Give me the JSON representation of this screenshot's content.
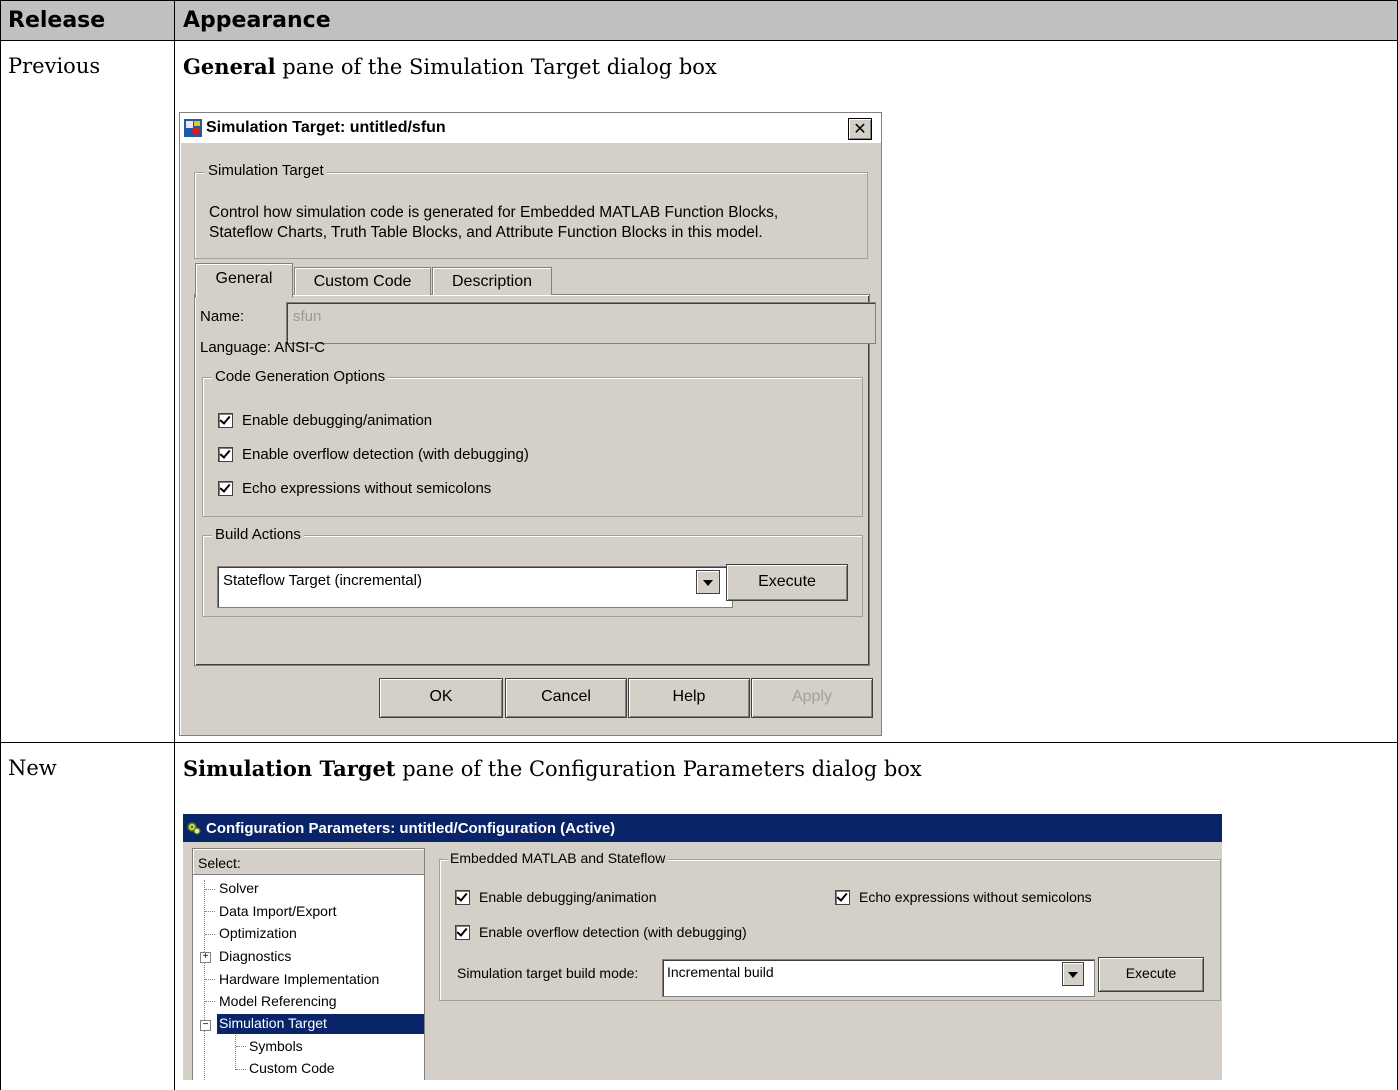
{
  "table": {
    "header": {
      "col1": "Release",
      "col2": "Appearance"
    },
    "rows": [
      {
        "release": "Previous",
        "caption_bold": "General",
        "caption_rest": " pane of the Simulation Target dialog box"
      },
      {
        "release": "New",
        "caption_bold": "Simulation Target",
        "caption_rest": " pane of the Configuration Parameters dialog box"
      }
    ]
  },
  "old_dialog": {
    "title": "Simulation Target: untitled/sfun",
    "group_title": "Simulation Target",
    "description_line1": "Control how simulation code is generated for Embedded MATLAB Function Blocks,",
    "description_line2": "Stateflow Charts, Truth Table Blocks, and Attribute Function Blocks in this model.",
    "tabs": [
      "General",
      "Custom Code",
      "Description"
    ],
    "active_tab": "General",
    "name_label": "Name:",
    "name_value": "sfun",
    "language": "Language: ANSI-C",
    "code_gen_group": "Code Generation Options",
    "checkboxes": [
      {
        "label": "Enable debugging/animation",
        "checked": true
      },
      {
        "label": "Enable overflow detection (with debugging)",
        "checked": true
      },
      {
        "label": "Echo expressions without semicolons",
        "checked": true
      }
    ],
    "build_group": "Build Actions",
    "build_selected": "Stateflow Target (incremental)",
    "execute_label": "Execute",
    "buttons": {
      "ok": "OK",
      "cancel": "Cancel",
      "help": "Help",
      "apply": "Apply"
    },
    "close_glyph": "✕"
  },
  "config_dialog": {
    "title": "Configuration Parameters: untitled/Configuration (Active)",
    "select_label": "Select:",
    "tree": [
      "Solver",
      "Data Import/Export",
      "Optimization",
      "Diagnostics",
      "Hardware Implementation",
      "Model Referencing",
      "Simulation Target",
      "Symbols",
      "Custom Code"
    ],
    "selected_tree_item": "Simulation Target",
    "group_title": "Embedded MATLAB and Stateflow",
    "checkboxes": [
      {
        "label": "Enable debugging/animation",
        "checked": true
      },
      {
        "label": "Echo expressions without semicolons",
        "checked": true
      },
      {
        "label": "Enable overflow detection (with debugging)",
        "checked": true
      }
    ],
    "build_mode_label": "Simulation target build mode:",
    "build_mode_value": "Incremental build",
    "execute_label": "Execute",
    "expander_plus": "+",
    "expander_minus": "−"
  },
  "colors": {
    "header_bg": "#c0c0c0",
    "dialog_face": "#d4d0c8",
    "selection": "#0a246a",
    "title_active": "#0a246a"
  }
}
